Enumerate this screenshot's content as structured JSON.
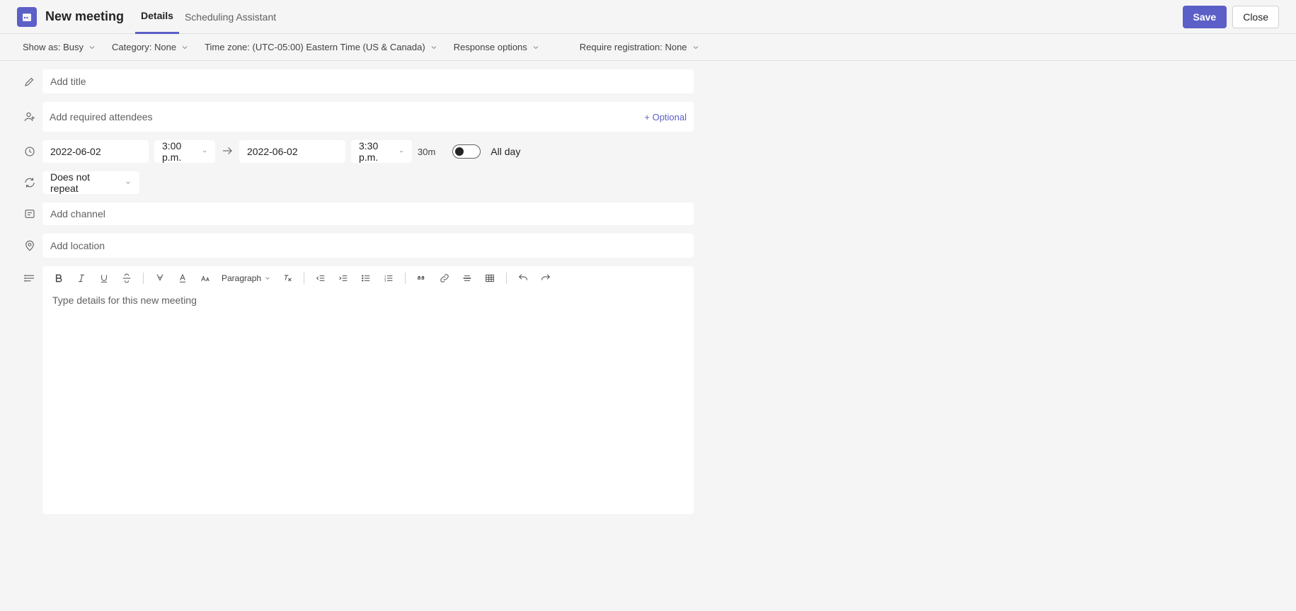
{
  "header": {
    "title": "New meeting",
    "tabs": [
      "Details",
      "Scheduling Assistant"
    ],
    "active_tab": 0,
    "save_label": "Save",
    "close_label": "Close"
  },
  "options": {
    "show_as": "Show as: Busy",
    "category": "Category: None",
    "timezone": "Time zone: (UTC-05:00) Eastern Time (US & Canada)",
    "response": "Response options",
    "registration": "Require registration: None"
  },
  "form": {
    "title_placeholder": "Add title",
    "title_value": "",
    "attendees_placeholder": "Add required attendees",
    "attendees_value": "",
    "optional_label": "+ Optional",
    "start_date": "2022-06-02",
    "start_time": "3:00 p.m.",
    "end_date": "2022-06-02",
    "end_time": "3:30 p.m.",
    "duration": "30m",
    "all_day_label": "All day",
    "all_day": false,
    "repeat": "Does not repeat",
    "channel_placeholder": "Add channel",
    "channel_value": "",
    "location_placeholder": "Add location",
    "location_value": ""
  },
  "editor": {
    "paragraph_label": "Paragraph",
    "placeholder": "Type details for this new meeting"
  }
}
